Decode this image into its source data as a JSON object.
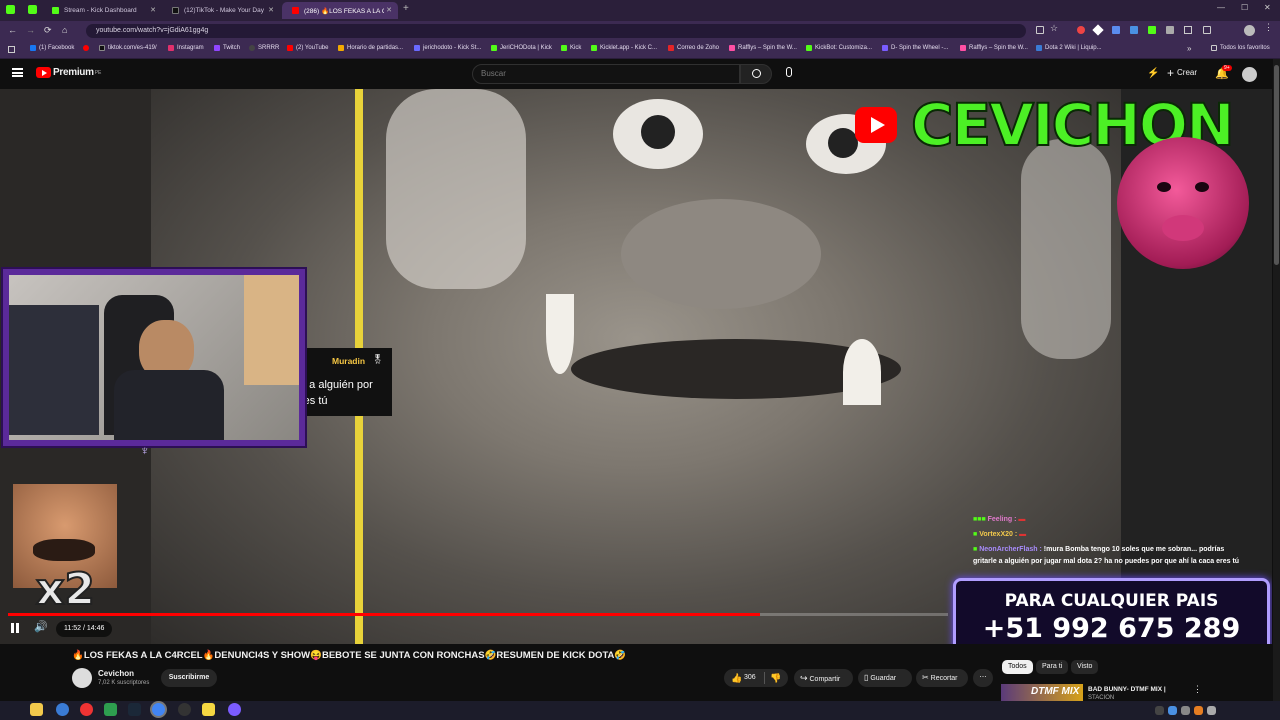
{
  "browser": {
    "tabs": [
      {
        "label": "Stream - Kick Dashboard",
        "color": "#53fc18"
      },
      {
        "label": "(12)TikTok - Make Your Day",
        "color": "#111111"
      },
      {
        "label": "(286) 🔥LOS FEKAS A LA C...",
        "color": "#ff0000"
      }
    ],
    "url": "youtube.com/watch?v=jGdiA61gg4g",
    "bookmarks": [
      {
        "label": "(1) Facebook",
        "color": "#1877f2"
      },
      {
        "label": "tiktok.com/es-419/",
        "color": "#111111"
      },
      {
        "label": "Instagram",
        "color": "#e1306c"
      },
      {
        "label": "Twitch",
        "color": "#9146ff"
      },
      {
        "label": "SRRRR",
        "color": "#222222"
      },
      {
        "label": "(2) YouTube",
        "color": "#ff0000"
      },
      {
        "label": "Horario de partidas...",
        "color": "#f2a900"
      },
      {
        "label": "jerichodoto - Kick St...",
        "color": "#6a6aff"
      },
      {
        "label": "JeriCHODota | Kick",
        "color": "#53fc18"
      },
      {
        "label": "Kick",
        "color": "#53fc18"
      },
      {
        "label": "Kicklet.app - Kick C...",
        "color": "#53fc18"
      },
      {
        "label": "Correo de Zoho",
        "color": "#e42527"
      },
      {
        "label": "Rafflys – Spin the W...",
        "color": "#ff4fa3"
      },
      {
        "label": "KickBot: Customiza...",
        "color": "#53fc18"
      },
      {
        "label": "D- Spin the Wheel -...",
        "color": "#7a5cff"
      },
      {
        "label": "Rafflys – Spin the W...",
        "color": "#ff4fa3"
      },
      {
        "label": "Dota 2 Wiki | Liquip...",
        "color": "#3a7bd5"
      }
    ],
    "bookmarks_all": "Todos los favoritos"
  },
  "youtube": {
    "logo": "Premium",
    "logo_region": "PE",
    "search_placeholder": "Buscar",
    "create_label": "Crear",
    "notif_count": "9+"
  },
  "video": {
    "brand_name": "CEVICHON",
    "chat_popup_user": "Muradin",
    "chat_popup_text1": "e a alguién por",
    "chat_popup_text2": "res tú",
    "emote_multiplier": "x2",
    "chat": [
      {
        "user": "Feeling :",
        "color": "#e07acb",
        "text": ""
      },
      {
        "user": "VortexX20 :",
        "color": "#f2c94c",
        "text": ""
      },
      {
        "user": "NeonArcherFlash :",
        "color": "#a78bfa",
        "text": "!mura Bomba tengo 10 soles que me sobran... podrías"
      },
      {
        "user": "",
        "color": "#ffffff",
        "text": "gritarle a alguién por jugar mal dota 2? ha no puedes por que ahí la caca eres tú"
      }
    ],
    "promo_line1": "PARA CUALQUIER PAIS",
    "promo_line2": "+51 992 675 289",
    "time_current": "11:52",
    "time_sep": "/",
    "time_total": "14:46",
    "progress": 0.8
  },
  "meta": {
    "title": "🔥LOS FEKAS A LA C4RCEL🔥DENUNCI4S Y SHOW😝BEBOTE SE JUNTA CON RONCHAS🤣RESUMEN DE KICK DOTA🤣",
    "channel": "Cevichon",
    "subscribers": "7,02 K suscriptores",
    "subscribe_label": "Suscribirme",
    "likes": "306",
    "share_label": "Compartir",
    "save_label": "Guardar",
    "clip_label": "Recortar",
    "chips": [
      "Todos",
      "Para ti",
      "Visto"
    ],
    "rec_title": "BAD BUNNY- DTMF MIX |",
    "rec_sub": "STACION",
    "rec_thumb": "DTMF MIX"
  }
}
